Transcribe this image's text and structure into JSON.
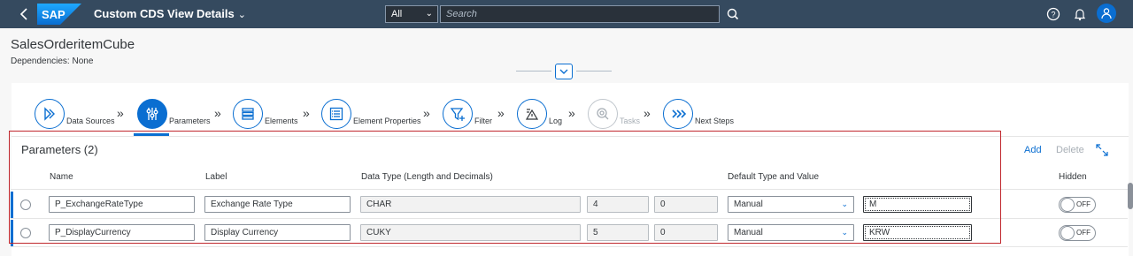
{
  "shell": {
    "back_icon": "back-icon",
    "logo_text": "SAP",
    "title": "Custom CDS View Details",
    "scope_value": "All",
    "search_placeholder": "Search",
    "colors": {
      "shell_bg": "#354a5f",
      "accent": "#0a6ed1"
    }
  },
  "header": {
    "object_title": "SalesOrderitemCube",
    "dependencies": "Dependencies: None"
  },
  "steps": [
    {
      "label": "Data Sources",
      "icon": "data-sources-icon",
      "state": "normal"
    },
    {
      "label": "Parameters",
      "icon": "parameters-icon",
      "state": "active"
    },
    {
      "label": "Elements",
      "icon": "elements-icon",
      "state": "normal"
    },
    {
      "label": "Element Properties",
      "icon": "element-properties-icon",
      "state": "normal"
    },
    {
      "label": "Filter",
      "icon": "filter-icon",
      "state": "normal"
    },
    {
      "label": "Log",
      "icon": "log-icon",
      "state": "normal"
    },
    {
      "label": "Tasks",
      "icon": "tasks-icon",
      "state": "disabled"
    },
    {
      "label": "Next Steps",
      "icon": "next-steps-icon",
      "state": "normal"
    }
  ],
  "table": {
    "title": "Parameters (2)",
    "add_label": "Add",
    "delete_label": "Delete",
    "columns": {
      "name": "Name",
      "label": "Label",
      "data_type": "Data Type (Length and Decimals)",
      "default": "Default Type and Value",
      "hidden": "Hidden"
    },
    "rows": [
      {
        "name": "P_ExchangeRateType",
        "label": "Exchange Rate Type",
        "type": "CHAR",
        "length": "4",
        "decimals": "0",
        "default_type": "Manual",
        "default_value": "M",
        "hidden": "OFF"
      },
      {
        "name": "P_DisplayCurrency",
        "label": "Display Currency",
        "type": "CUKY",
        "length": "5",
        "decimals": "0",
        "default_type": "Manual",
        "default_value": "KRW",
        "hidden": "OFF"
      }
    ]
  }
}
